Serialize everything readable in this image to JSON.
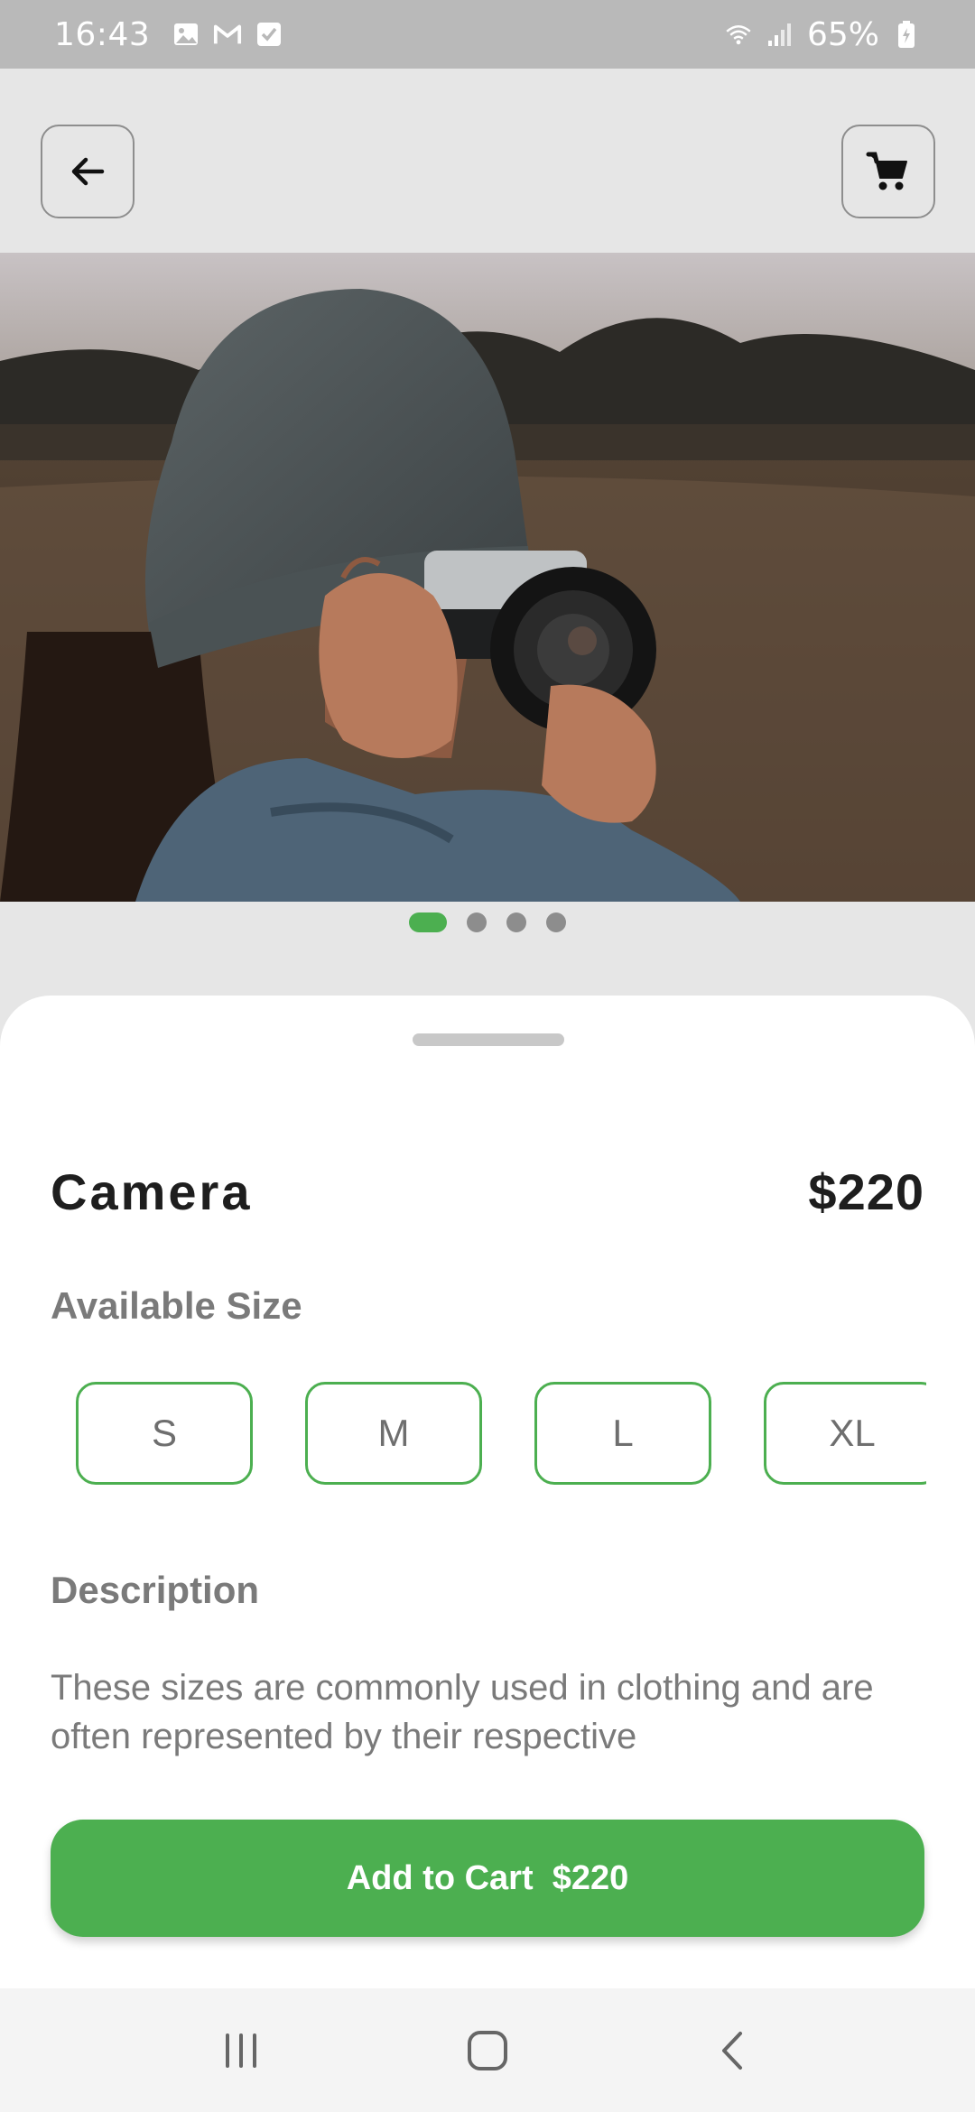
{
  "status_bar": {
    "time": "16:43",
    "battery": "65%",
    "left_icons": [
      "gallery-icon",
      "gmail-icon",
      "checkbox-icon"
    ],
    "right_icons": [
      "wifi-icon",
      "signal-icon",
      "battery-icon"
    ]
  },
  "app_bar": {
    "back_icon": "arrow-left-icon",
    "cart_icon": "shopping-cart-icon"
  },
  "gallery": {
    "image_subject": "person-with-camera-photo",
    "slide_count": 4,
    "active_slide": 1
  },
  "product": {
    "name": "Camera",
    "price": "$220"
  },
  "sizes": {
    "label": "Available Size",
    "options": [
      "S",
      "M",
      "L",
      "XL"
    ]
  },
  "description": {
    "label": "Description",
    "text": "These sizes are commonly used in clothing and are often represented by their respective"
  },
  "cta": {
    "label": "Add to Cart  $220"
  },
  "colors": {
    "accent": "#4caf50",
    "muted_text": "#7a7a7a",
    "title_text": "#1e1e1e"
  },
  "nav_bar": {
    "icons": [
      "recent-apps-icon",
      "home-icon",
      "back-nav-icon"
    ]
  }
}
